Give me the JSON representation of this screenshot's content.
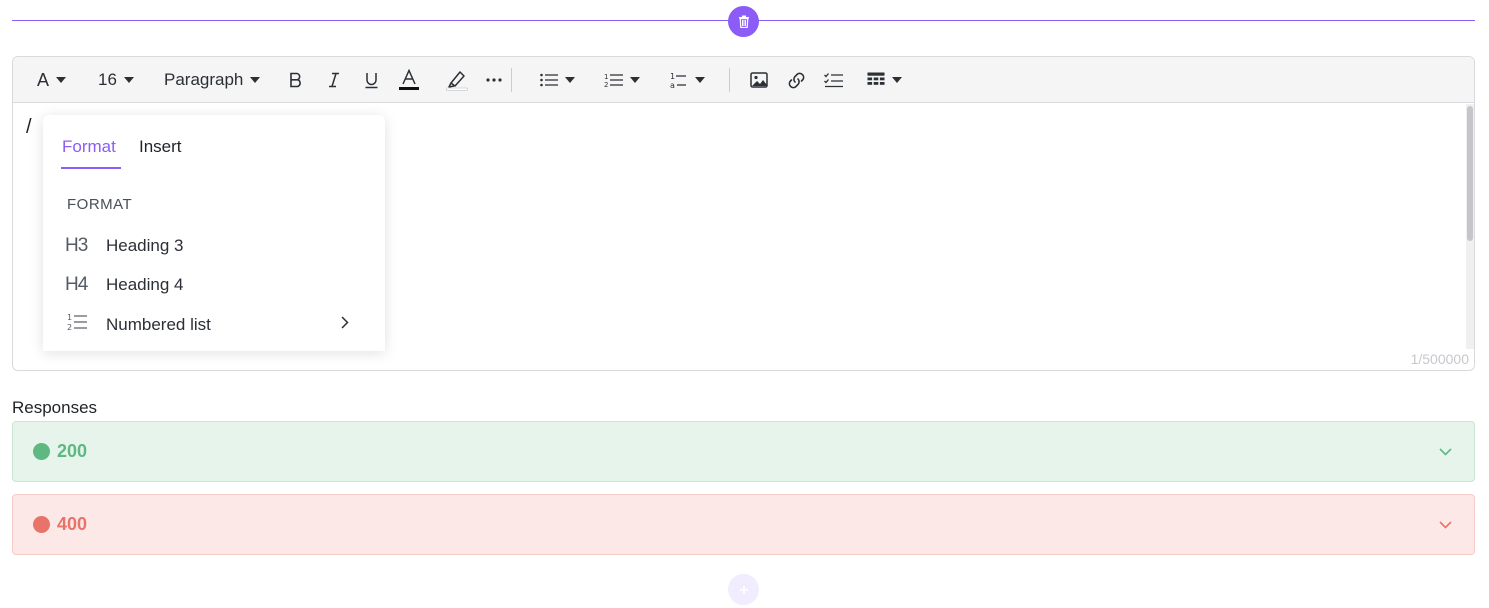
{
  "colors": {
    "accent": "#8b5cf6",
    "success": "#5db882",
    "error": "#e8736a"
  },
  "toolbar": {
    "font_family_glyph": "A",
    "font_size": "16",
    "block_style": "Paragraph"
  },
  "editor": {
    "content": "/",
    "char_count": "1/500000"
  },
  "slash_menu": {
    "tabs": [
      {
        "label": "Format"
      },
      {
        "label": "Insert"
      }
    ],
    "section_label": "FORMAT",
    "items": [
      {
        "icon": "H3",
        "label": "Heading 3"
      },
      {
        "icon": "H4",
        "label": "Heading 4"
      },
      {
        "icon": "numbered-list-icon",
        "label": "Numbered list"
      }
    ]
  },
  "responses": {
    "label": "Responses",
    "items": [
      {
        "code": "200"
      },
      {
        "code": "400"
      }
    ]
  }
}
